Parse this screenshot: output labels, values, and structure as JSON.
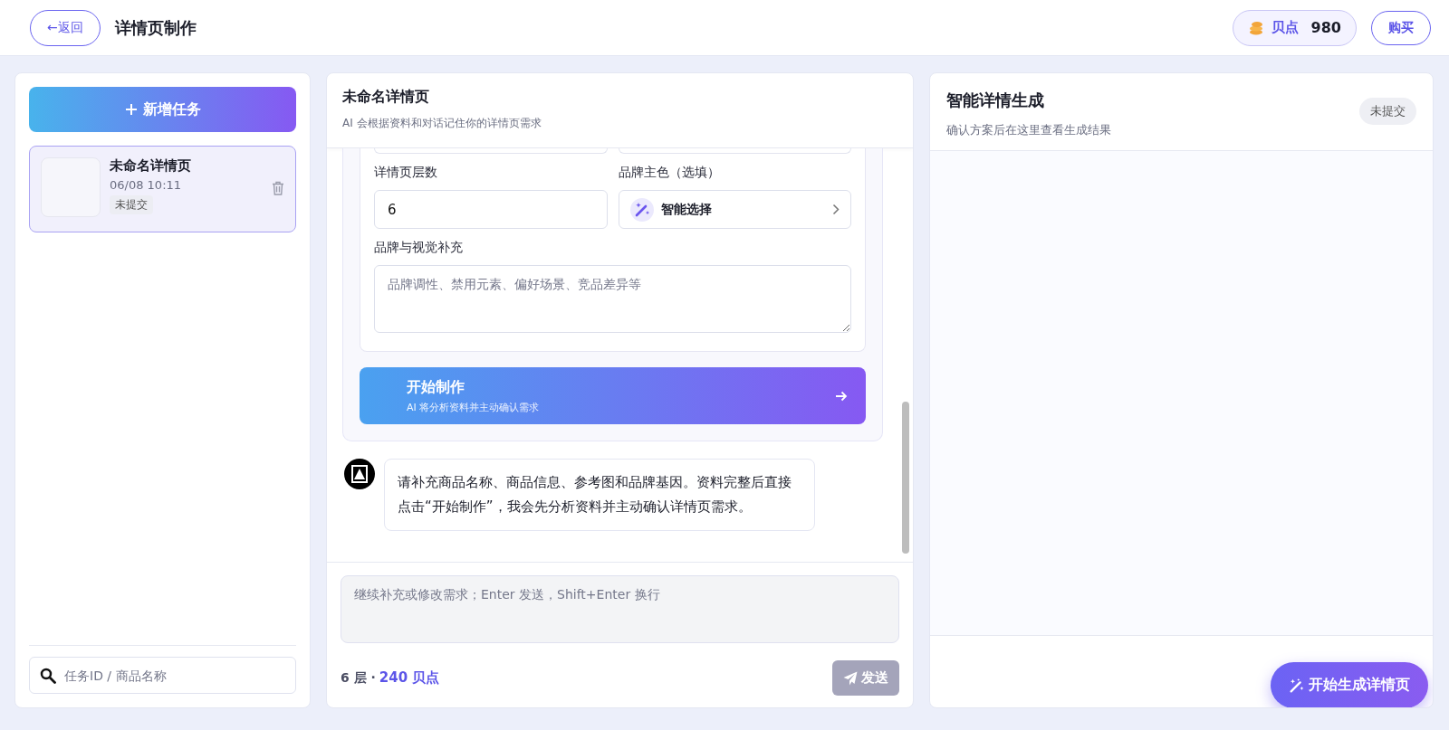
{
  "header": {
    "back_button": "←返回",
    "title": "详情页制作",
    "points": {
      "label": "贝点",
      "value": "980"
    },
    "buy_button": "购买"
  },
  "sidebar": {
    "new_task_button": "新增任务",
    "tasks": [
      {
        "title": "未命名详情页",
        "time": "06/08 10:11",
        "status": "未提交",
        "selected": true
      }
    ],
    "search": {
      "placeholder": "任务ID / 商品名称"
    }
  },
  "chat": {
    "title": "未命名详情页",
    "subtitle": "AI 会根据资料和对话记住你的详情页需求",
    "fields": [
      {
        "kind": "input",
        "label": "详情页层数",
        "value": "6"
      },
      {
        "kind": "select",
        "label": "品牌主色（选填）",
        "value": "智能选择"
      },
      {
        "kind": "textarea",
        "label": "品牌与视觉补充",
        "placeholder": "品牌调性、禁用元素、偏好场景、竞品差异等"
      }
    ],
    "start_button": {
      "title": "开始制作",
      "subtitle": "AI 将分析资料并主动确认需求"
    },
    "messages": [
      {
        "text": "请补充商品名称、商品信息、参考图和品牌基因。资料完整后直接点击“开始制作”，我会先分析资料并主动确认详情页需求。"
      }
    ],
    "composer": {
      "placeholder": "继续补充或修改需求；Enter 发送，Shift+Enter 换行"
    },
    "footer": {
      "layers": "6 层 ·",
      "cost": "240 贝点"
    },
    "send_button": {
      "label": "发送",
      "disabled": true
    }
  },
  "result": {
    "title": "智能详情生成",
    "subtitle": "确认方案后在这里查看生成结果",
    "status": "未提交",
    "generate_button": "开始生成详情页"
  }
}
